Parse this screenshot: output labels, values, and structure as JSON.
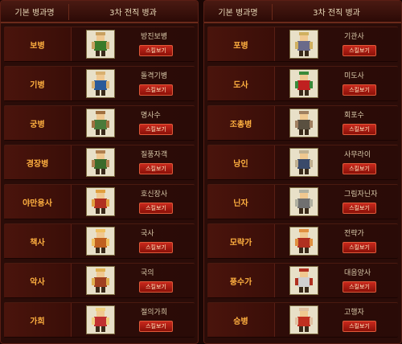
{
  "left": {
    "header": {
      "base_label": "기본 병과명",
      "third_label": "3차 전직 병과"
    },
    "rows": [
      {
        "base": "보병",
        "job": "방진보병",
        "button": "스킬보기"
      },
      {
        "base": "기병",
        "job": "돌격기병",
        "button": "스킬보기"
      },
      {
        "base": "궁병",
        "job": "명사수",
        "button": "스킬보기"
      },
      {
        "base": "경장병",
        "job": "질풍자객",
        "button": "스킬보기"
      },
      {
        "base": "야만용사",
        "job": "호신장사",
        "button": "스킬보기"
      },
      {
        "base": "책사",
        "job": "국사",
        "button": "스킬보기"
      },
      {
        "base": "악사",
        "job": "국의",
        "button": "스킬보기"
      },
      {
        "base": "가희",
        "job": "절의가희",
        "button": "스킬보기"
      }
    ]
  },
  "right": {
    "header": {
      "base_label": "기본 병과명",
      "third_label": "3차 전직 병과"
    },
    "rows": [
      {
        "base": "포병",
        "job": "기관사",
        "button": "스킬보기"
      },
      {
        "base": "도사",
        "job": "미도사",
        "button": "스킬보기"
      },
      {
        "base": "조총병",
        "job": "회포수",
        "button": "스킬보기"
      },
      {
        "base": "낭인",
        "job": "사무라이",
        "button": "스킬보기"
      },
      {
        "base": "닌자",
        "job": "그림자닌자",
        "button": "스킬보기"
      },
      {
        "base": "모략가",
        "job": "전략가",
        "button": "스킬보기"
      },
      {
        "base": "풍수가",
        "job": "대음양사",
        "button": "스킬보기"
      },
      {
        "base": "승병",
        "job": "고행자",
        "button": "스킬보기"
      }
    ]
  },
  "colors": {
    "accent": "#ffb040",
    "button": "#c8281c",
    "panel": "#2a0c08"
  }
}
